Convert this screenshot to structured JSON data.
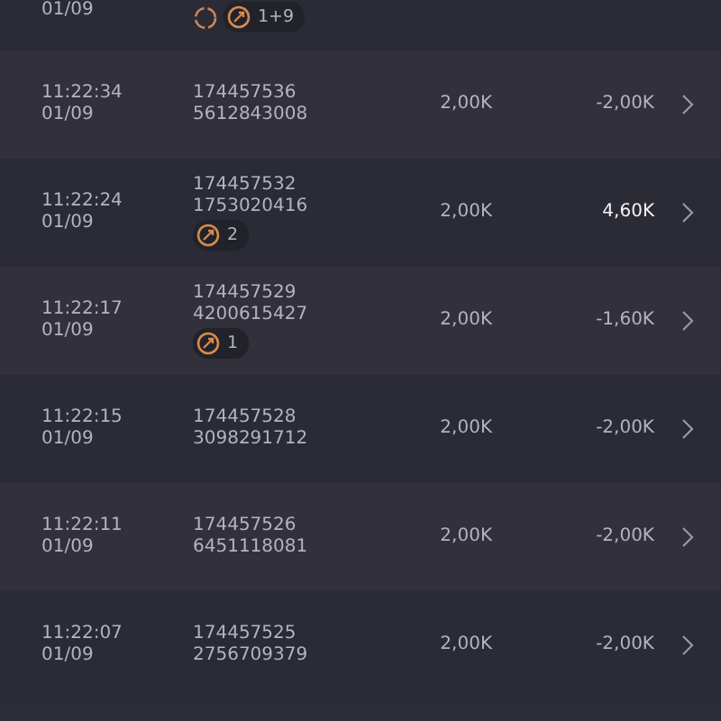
{
  "rows": [
    {
      "date": "01/09",
      "badges": [
        {
          "kind": "spinner"
        },
        {
          "kind": "pill",
          "count": "1+9"
        }
      ]
    },
    {
      "time": "11:22:34",
      "date": "01/09",
      "ids": [
        "174457536",
        "5612843008"
      ],
      "stake": "2,00K",
      "result": "-2,00K",
      "win": false,
      "badges": []
    },
    {
      "time": "11:22:24",
      "date": "01/09",
      "ids": [
        "174457532",
        "1753020416"
      ],
      "stake": "2,00K",
      "result": "4,60K",
      "win": true,
      "badges": [
        {
          "kind": "pill",
          "count": "2"
        }
      ]
    },
    {
      "time": "11:22:17",
      "date": "01/09",
      "ids": [
        "174457529",
        "4200615427"
      ],
      "stake": "2,00K",
      "result": "-1,60K",
      "win": false,
      "badges": [
        {
          "kind": "pill",
          "count": "1"
        }
      ]
    },
    {
      "time": "11:22:15",
      "date": "01/09",
      "ids": [
        "174457528",
        "3098291712"
      ],
      "stake": "2,00K",
      "result": "-2,00K",
      "win": false,
      "badges": []
    },
    {
      "time": "11:22:11",
      "date": "01/09",
      "ids": [
        "174457526",
        "6451118081"
      ],
      "stake": "2,00K",
      "result": "-2,00K",
      "win": false,
      "badges": []
    },
    {
      "time": "11:22:07",
      "date": "01/09",
      "ids": [
        "174457525",
        "2756709379"
      ],
      "stake": "2,00K",
      "result": "-2,00K",
      "win": false,
      "badges": []
    }
  ]
}
